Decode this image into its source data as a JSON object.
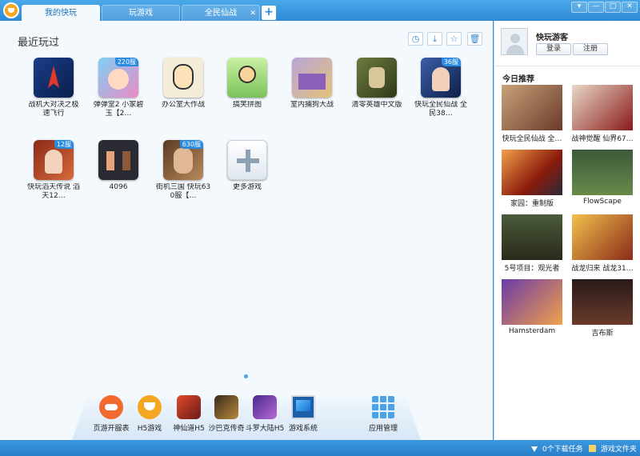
{
  "tabs": [
    {
      "label": "我的快玩",
      "active": true
    },
    {
      "label": "玩游戏",
      "active": false
    },
    {
      "label": "全民仙战",
      "active": false
    }
  ],
  "tab_add_label": "+",
  "tab_close_label": "✕",
  "window_controls": [
    "▾",
    "—",
    "□",
    "✕"
  ],
  "main": {
    "section_title": "最近玩过",
    "tools": [
      {
        "name": "history",
        "glyph": "◷"
      },
      {
        "name": "download",
        "glyph": "⤓"
      },
      {
        "name": "favorite",
        "glyph": "☆"
      },
      {
        "name": "delete",
        "glyph": "🗑"
      }
    ],
    "games": [
      {
        "label": "战机大对决之极速飞行",
        "badge": ""
      },
      {
        "label": "弹弹堂2 小家碧玉【2…",
        "badge": "220服"
      },
      {
        "label": "办公室大作战",
        "badge": ""
      },
      {
        "label": "搞笑拼图",
        "badge": ""
      },
      {
        "label": "室内捕狗大战",
        "badge": ""
      },
      {
        "label": "清零英雄中文版",
        "badge": ""
      },
      {
        "label": "快玩全民仙战 全民38…",
        "badge": "36服"
      },
      {
        "label": "快玩滔天传说 滔天12…",
        "badge": "12服"
      },
      {
        "label": "4096",
        "badge": ""
      },
      {
        "label": "街机三国 快玩630服【…",
        "badge": "630服"
      },
      {
        "label": "更多游戏",
        "badge": ""
      }
    ]
  },
  "dock": [
    {
      "label": "页游开服表"
    },
    {
      "label": "H5游戏"
    },
    {
      "label": "神仙道H5"
    },
    {
      "label": "沙巴克传奇"
    },
    {
      "label": "斗罗大陆H5"
    },
    {
      "label": "游戏系统"
    },
    {
      "label": "应用管理"
    }
  ],
  "sidebar": {
    "username": "快玩游客",
    "login_label": "登录",
    "register_label": "注册",
    "title": "今日推荐",
    "recommendations": [
      {
        "label": "快玩全民仙战 全…"
      },
      {
        "label": "战神觉醒 仙界67…"
      },
      {
        "label": "家园：重制版"
      },
      {
        "label": "FlowScape"
      },
      {
        "label": "5号项目：观光者"
      },
      {
        "label": "战龙归来 战龙31…"
      },
      {
        "label": "Hamsterdam"
      },
      {
        "label": "吉布斯"
      }
    ]
  },
  "status": {
    "downloads": "0个下载任务",
    "folder": "游戏文件夹"
  },
  "colors": {
    "accent": "#2d8ad6",
    "background": "#f4f9fe",
    "badge": "#2a8ce0"
  }
}
